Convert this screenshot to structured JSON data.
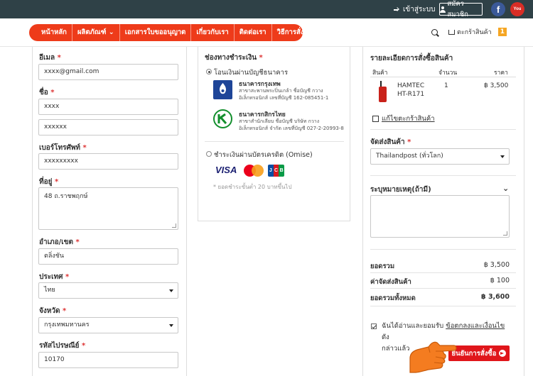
{
  "topbar": {
    "login_label": "เข้าสู่ระบบ",
    "register_label": "สมัครสมาชิก",
    "facebook": "f",
    "youtube": "You"
  },
  "nav": {
    "items": [
      "หน้าหลัก",
      "ผลิตภัณฑ์",
      "เอกสารใบขออนุญาต",
      "เกี่ยวกับเรา",
      "ติดต่อเรา",
      "วิธีการสั่งซื้อ"
    ],
    "cart_label": "ตะกร้าสินค้า",
    "cart_count": "1",
    "accent": "#ee3b1a"
  },
  "form": {
    "email_label": "อีเมล",
    "email_value": "xxxx@gmail.com",
    "name_label": "ชื่อ",
    "first_name": "xxxx",
    "last_name": "xxxxxx",
    "phone_label": "เบอร์โทรศัพท์",
    "phone_value": "xxxxxxxxx",
    "address_label": "ที่อยู่",
    "address_value": "48 ถ.ราชพฤกษ์",
    "district_label": "อำเภอ/เขต",
    "district_value": "ตลิ่งชัน",
    "country_label": "ประเทศ",
    "country_value": "ไทย",
    "province_label": "จังหวัด",
    "province_value": "กรุงเทพมหานคร",
    "postcode_label": "รหัสไปรษณีย์",
    "postcode_value": "10170",
    "required_mark": "*"
  },
  "payment": {
    "title": "ช่องทางชำระเงิน",
    "transfer_label": "โอนเงินผ่านบัญชีธนาคาร",
    "banks": [
      {
        "name": "ธนาคารกรุงเทพ",
        "line1": "สาขาสะพานพระปิ่นเกล้า ชื่อบัญชี กวาง",
        "line2": "อิเล็กทรอนิกส์ เลขที่บัญชี 162-085451-1"
      },
      {
        "name": "ธนาคารกสิกรไทย",
        "line1": "สาขาสำนักเลียบ ชื่อบัญชี บริษัท กวาง",
        "line2": "อิเล็กทรอนิกส์ จำกัด เลขที่บัญชี 027-2-20993-8"
      }
    ],
    "card_label": "ชำระเงินผ่านบัตรเครดิต (Omise)",
    "visa": "VISA",
    "jcb": [
      "J",
      "C",
      "B"
    ],
    "note": "* ยอดชำระขั้นต่ำ 20 บาทขึ้นไป"
  },
  "order": {
    "title": "รายละเอียดการสั่งซื้อสินค้า",
    "col_product": "สินค้า",
    "col_qty": "จำนวน",
    "col_price": "ราคา",
    "item_name_1": "HAMTEC",
    "item_name_2": "HT-R171",
    "item_qty": "1",
    "item_price": "฿ 3,500",
    "edit_cart": "แก้ไขตะกร้าสินค้า",
    "shipping_label": "จัดส่งสินค้า",
    "shipping_value": "Thailandpost (ทั่วโลก)",
    "remark_label": "ระบุหมายเหตุ(ถ้ามี)",
    "subtotal_label": "ยอดรวม",
    "subtotal_value": "฿ 3,500",
    "shipping_cost_label": "ค่าจัดส่งสินค้า",
    "shipping_cost_value": "฿ 100",
    "total_label": "ยอดรวมทั้งหมด",
    "total_value": "฿ 3,600",
    "agree_text": "ฉันได้อ่านและยอมรับ",
    "agree_link": "ข้อตกลงและเงื่อนไข",
    "agree_tail_1": "ดัง",
    "agree_tail_2": "กล่าวแล้ว",
    "confirm_label": "ยืนยันการสั่งซื้อ"
  }
}
